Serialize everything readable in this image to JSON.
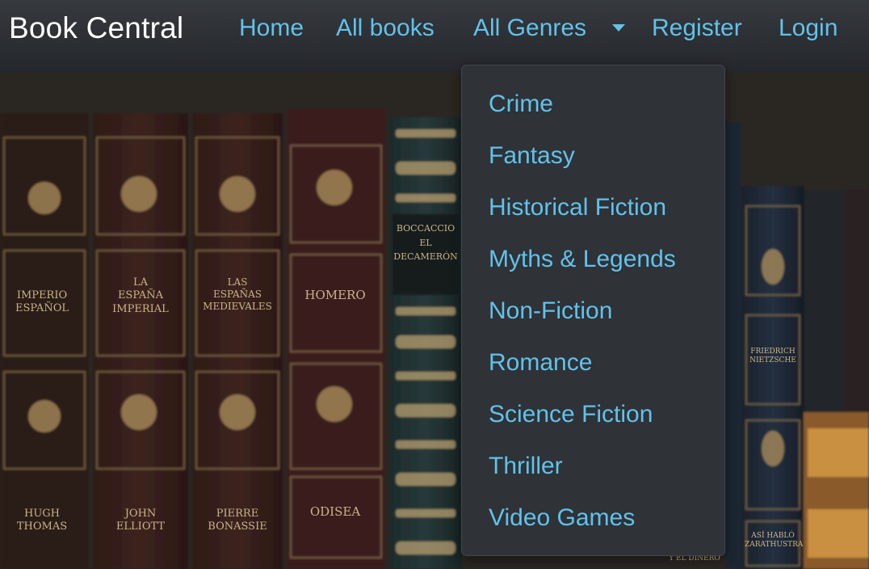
{
  "navbar": {
    "brand": "Book Central",
    "links": {
      "home": "Home",
      "all_books": "All books",
      "all_genres": "All Genres",
      "register": "Register",
      "login": "Login"
    }
  },
  "genres_dropdown": {
    "items": [
      "Crime",
      "Fantasy",
      "Historical Fiction",
      "Myths & Legends",
      "Non-Fiction",
      "Romance",
      "Science Fiction",
      "Thriller",
      "Video Games"
    ]
  },
  "background_book_spines": {
    "book1": [
      "IMPERIO",
      "ESPAÑOL"
    ],
    "book2": [
      "LA",
      "ESPAÑA",
      "IMPERIAL"
    ],
    "book3": [
      "LAS",
      "ESPAÑAS",
      "MEDIEVALES"
    ],
    "book4_top": "HOMERO",
    "book4_bottom": "ODISEA",
    "book5": [
      "BOCCACCIO",
      "EL",
      "DECAMERÓN"
    ],
    "book6": [
      "HUGH",
      "THOMAS"
    ],
    "book7": [
      "JOHN",
      "ELLIOTT"
    ],
    "book8": [
      "PIERRE",
      "BONASSIE"
    ],
    "book9": [
      "FRIEDRICH",
      "NIETZSCHE"
    ],
    "book10": [
      "ASÍ HABLÓ",
      "ZARATHUSTRA"
    ],
    "book11": "Y EL DINERO"
  },
  "colors": {
    "navbar_bg": "#2c2f33",
    "link": "#61c2ea",
    "brand": "#ffffff",
    "dropdown_bg": "#2f3237"
  },
  "icons": {
    "dropdown_caret": "caret-down-icon"
  }
}
